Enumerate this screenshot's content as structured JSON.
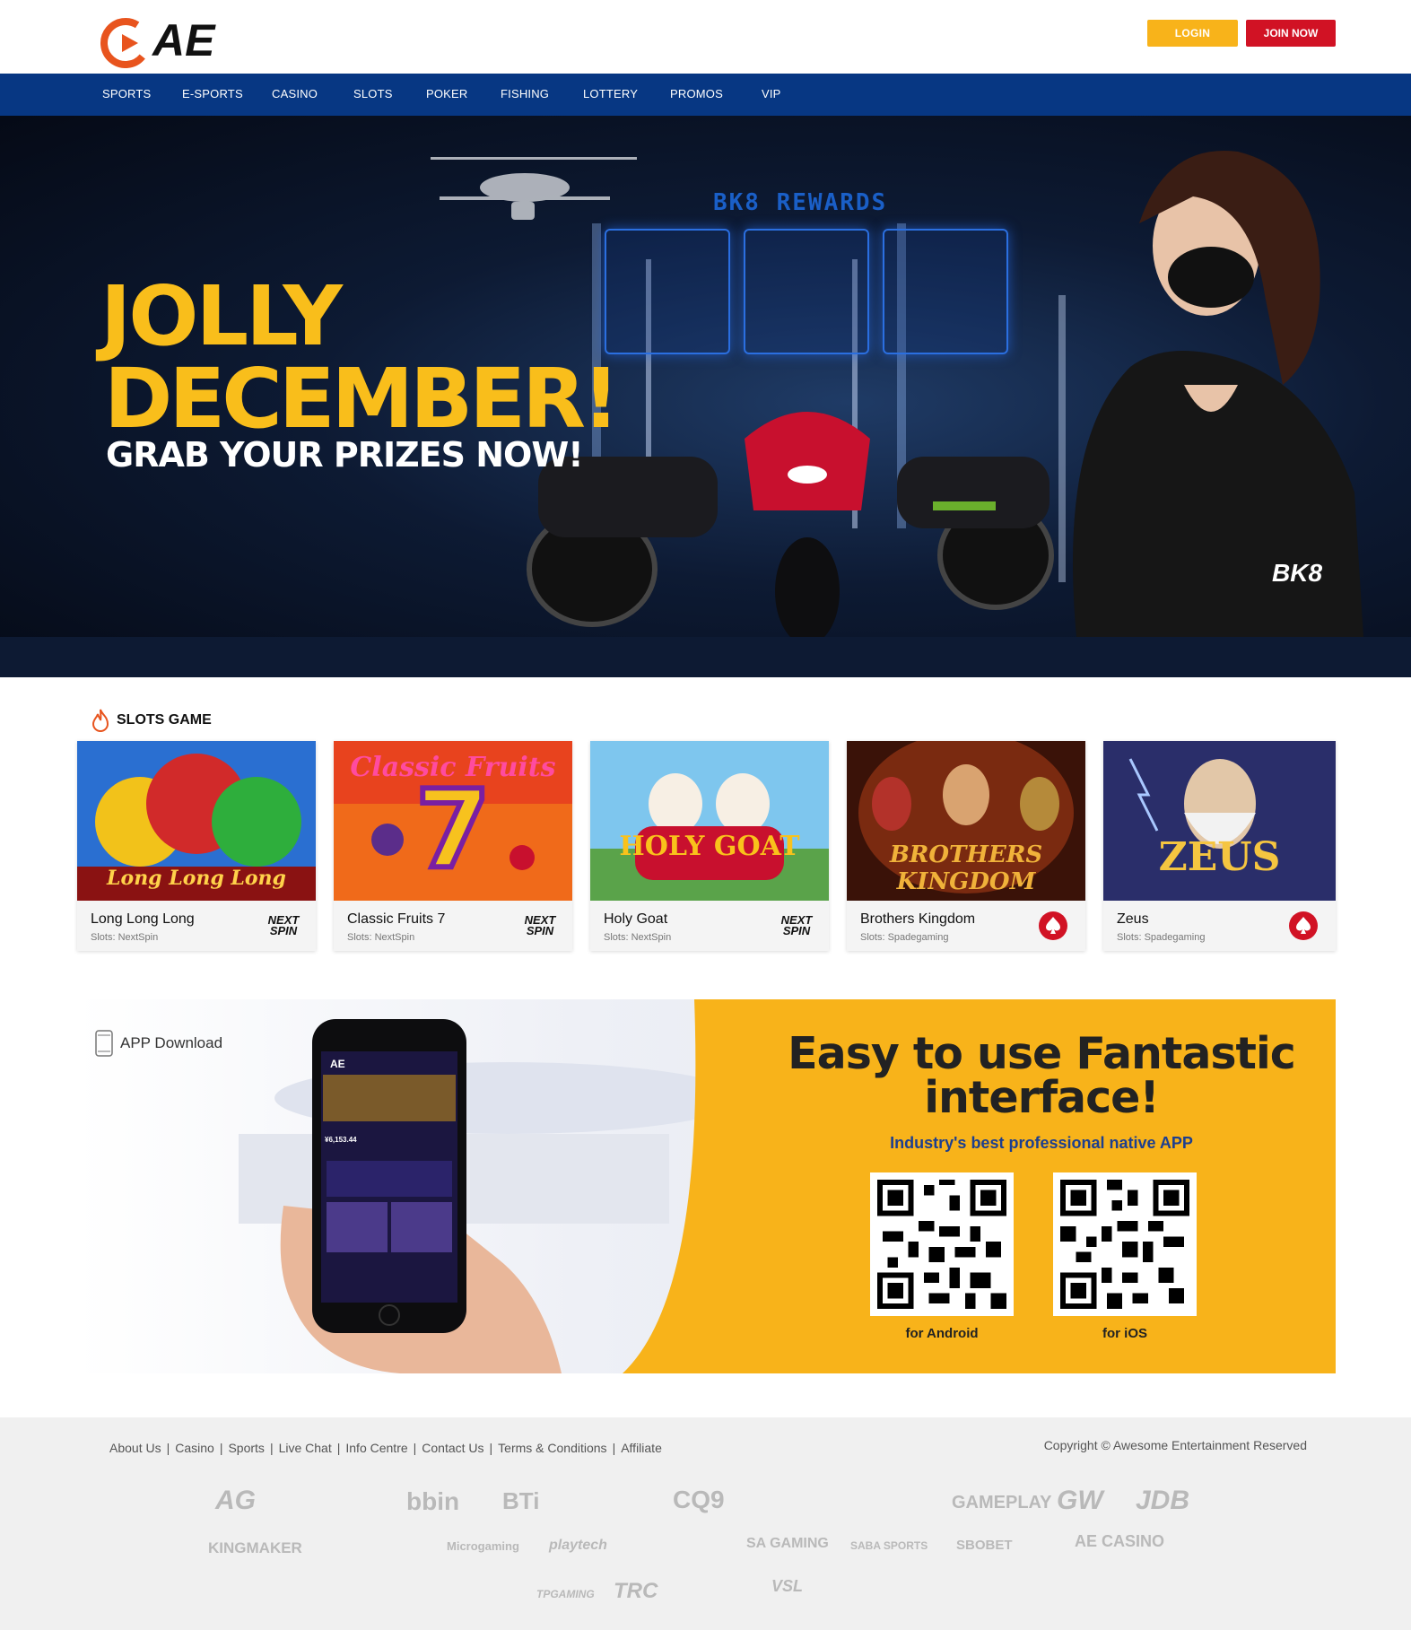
{
  "header": {
    "logo_text": "AE",
    "login_label": "LOGIN",
    "join_label": "JOIN NOW"
  },
  "nav": {
    "items": [
      "SPORTS",
      "E-SPORTS",
      "CASINO",
      "SLOTS",
      "POKER",
      "FISHING",
      "LOTTERY",
      "PROMOS",
      "VIP"
    ]
  },
  "hero": {
    "title_line1": "JOLLY",
    "title_line2": "DECEMBER!",
    "subtitle": "GRAB YOUR PRIZES NOW!",
    "rewards_label": "BK8 REWARDS",
    "brand": "BK8"
  },
  "slots": {
    "section_title": "SLOTS GAME",
    "games": [
      {
        "name": "Long Long Long",
        "provider": "Slots: NextSpin",
        "art_text": "Long Long Long",
        "logo": "NEXT SPIN"
      },
      {
        "name": "Classic Fruits 7",
        "provider": "Slots: NextSpin",
        "art_text": "Classic Fruits",
        "logo": "NEXT SPIN"
      },
      {
        "name": "Holy Goat",
        "provider": "Slots: NextSpin",
        "art_text": "HOLY GOAT",
        "logo": "NEXT SPIN"
      },
      {
        "name": "Brothers Kingdom",
        "provider": "Slots: Spadegaming",
        "art_text": "BROTHERS KINGDOM",
        "logo": "spade-icon"
      },
      {
        "name": "Zeus",
        "provider": "Slots: Spadegaming",
        "art_text": "ZEUS",
        "logo": "spade-icon"
      }
    ]
  },
  "app": {
    "label": "APP Download",
    "headline_line1": "Easy to use Fantastic",
    "headline_line2": "interface!",
    "tagline": "Industry's best professional native APP",
    "android_label": "for Android",
    "ios_label": "for iOS",
    "phone_brand": "AE",
    "phone_balance": "¥6,153.44"
  },
  "footer": {
    "links": [
      "About Us",
      "Casino",
      "Sports",
      "Live Chat",
      "Info Centre",
      "Contact Us",
      "Terms & Conditions",
      "Affiliate"
    ],
    "copyright": "Copyright © Awesome Entertainment Reserved",
    "partners_row1": [
      "AG",
      "bbin",
      "BTi",
      "CQ9",
      "GAMEPLAY",
      "GW",
      "JDB"
    ],
    "partners_row2": [
      "KINGMAKER",
      "Microgaming",
      "playtech",
      "SA GAMING",
      "SABA SPORTS",
      "SBOBET",
      "AE CASINO"
    ],
    "partners_row3": [
      "TPGAMING",
      "TRC",
      "VSL"
    ]
  },
  "colors": {
    "brand_yellow": "#f9be1b",
    "join_red": "#d11224",
    "nav_blue": "#073783"
  }
}
